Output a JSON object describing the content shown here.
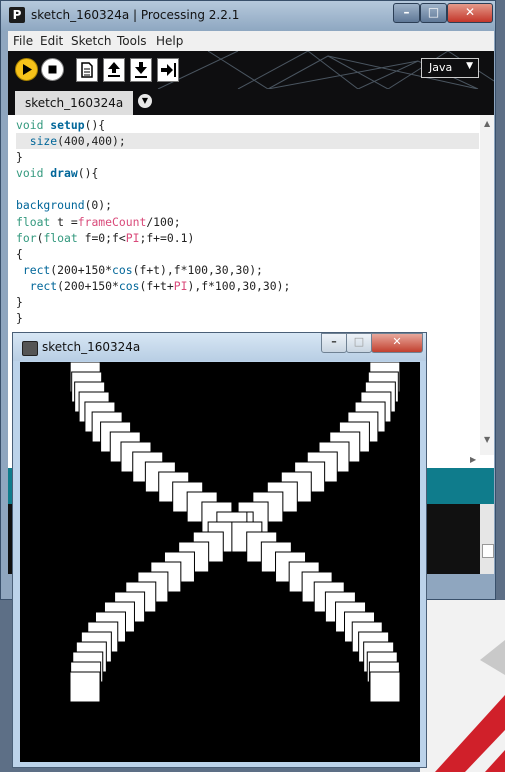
{
  "ide": {
    "app_icon": "P",
    "window_title": "sketch_160324a | Processing 2.2.1",
    "window_controls": {
      "minimize": "–",
      "maximize": "□",
      "close": "✕"
    },
    "menu": [
      "File",
      "Edit",
      "Sketch",
      "Tools",
      "Help"
    ],
    "toolbar": {
      "buttons": [
        "run-icon",
        "stop-icon",
        "new-icon",
        "open-icon",
        "save-icon",
        "export-icon"
      ]
    },
    "mode": {
      "label": "Java",
      "chevron": "▼"
    },
    "tab": {
      "label": "sketch_160324a",
      "menu_glyph": "▼"
    },
    "code": [
      "void setup(){",
      "  size(400,400);",
      "}",
      "void draw(){",
      "",
      "background(0);",
      "float t =frameCount/100;",
      "for(float f=0;f<PI;f+=0.1)",
      "{",
      " rect(200+150*cos(f+t),f*100,30,30);",
      "  rect(200+150*cos(f+t+PI),f*100,30,30);",
      "}",
      "}"
    ],
    "scroll_glyphs": {
      "up": "▲",
      "down": "▼",
      "right": "▶"
    }
  },
  "sketch": {
    "window_title": "sketch_160324a",
    "window_controls": {
      "minimize": "–",
      "maximize": "□",
      "close": "✕"
    },
    "canvas": {
      "width": 400,
      "height": 400,
      "background": "#000000",
      "fill": "#ffffff",
      "stroke": "#000000",
      "rect_size": 30,
      "t": 0.05
    }
  },
  "colors": {
    "keyword": "#33997e",
    "function": "#006699",
    "builtin_var": "#d94a7a",
    "status_bar": "#0f7c8c",
    "run_button": "#f6c21a"
  }
}
